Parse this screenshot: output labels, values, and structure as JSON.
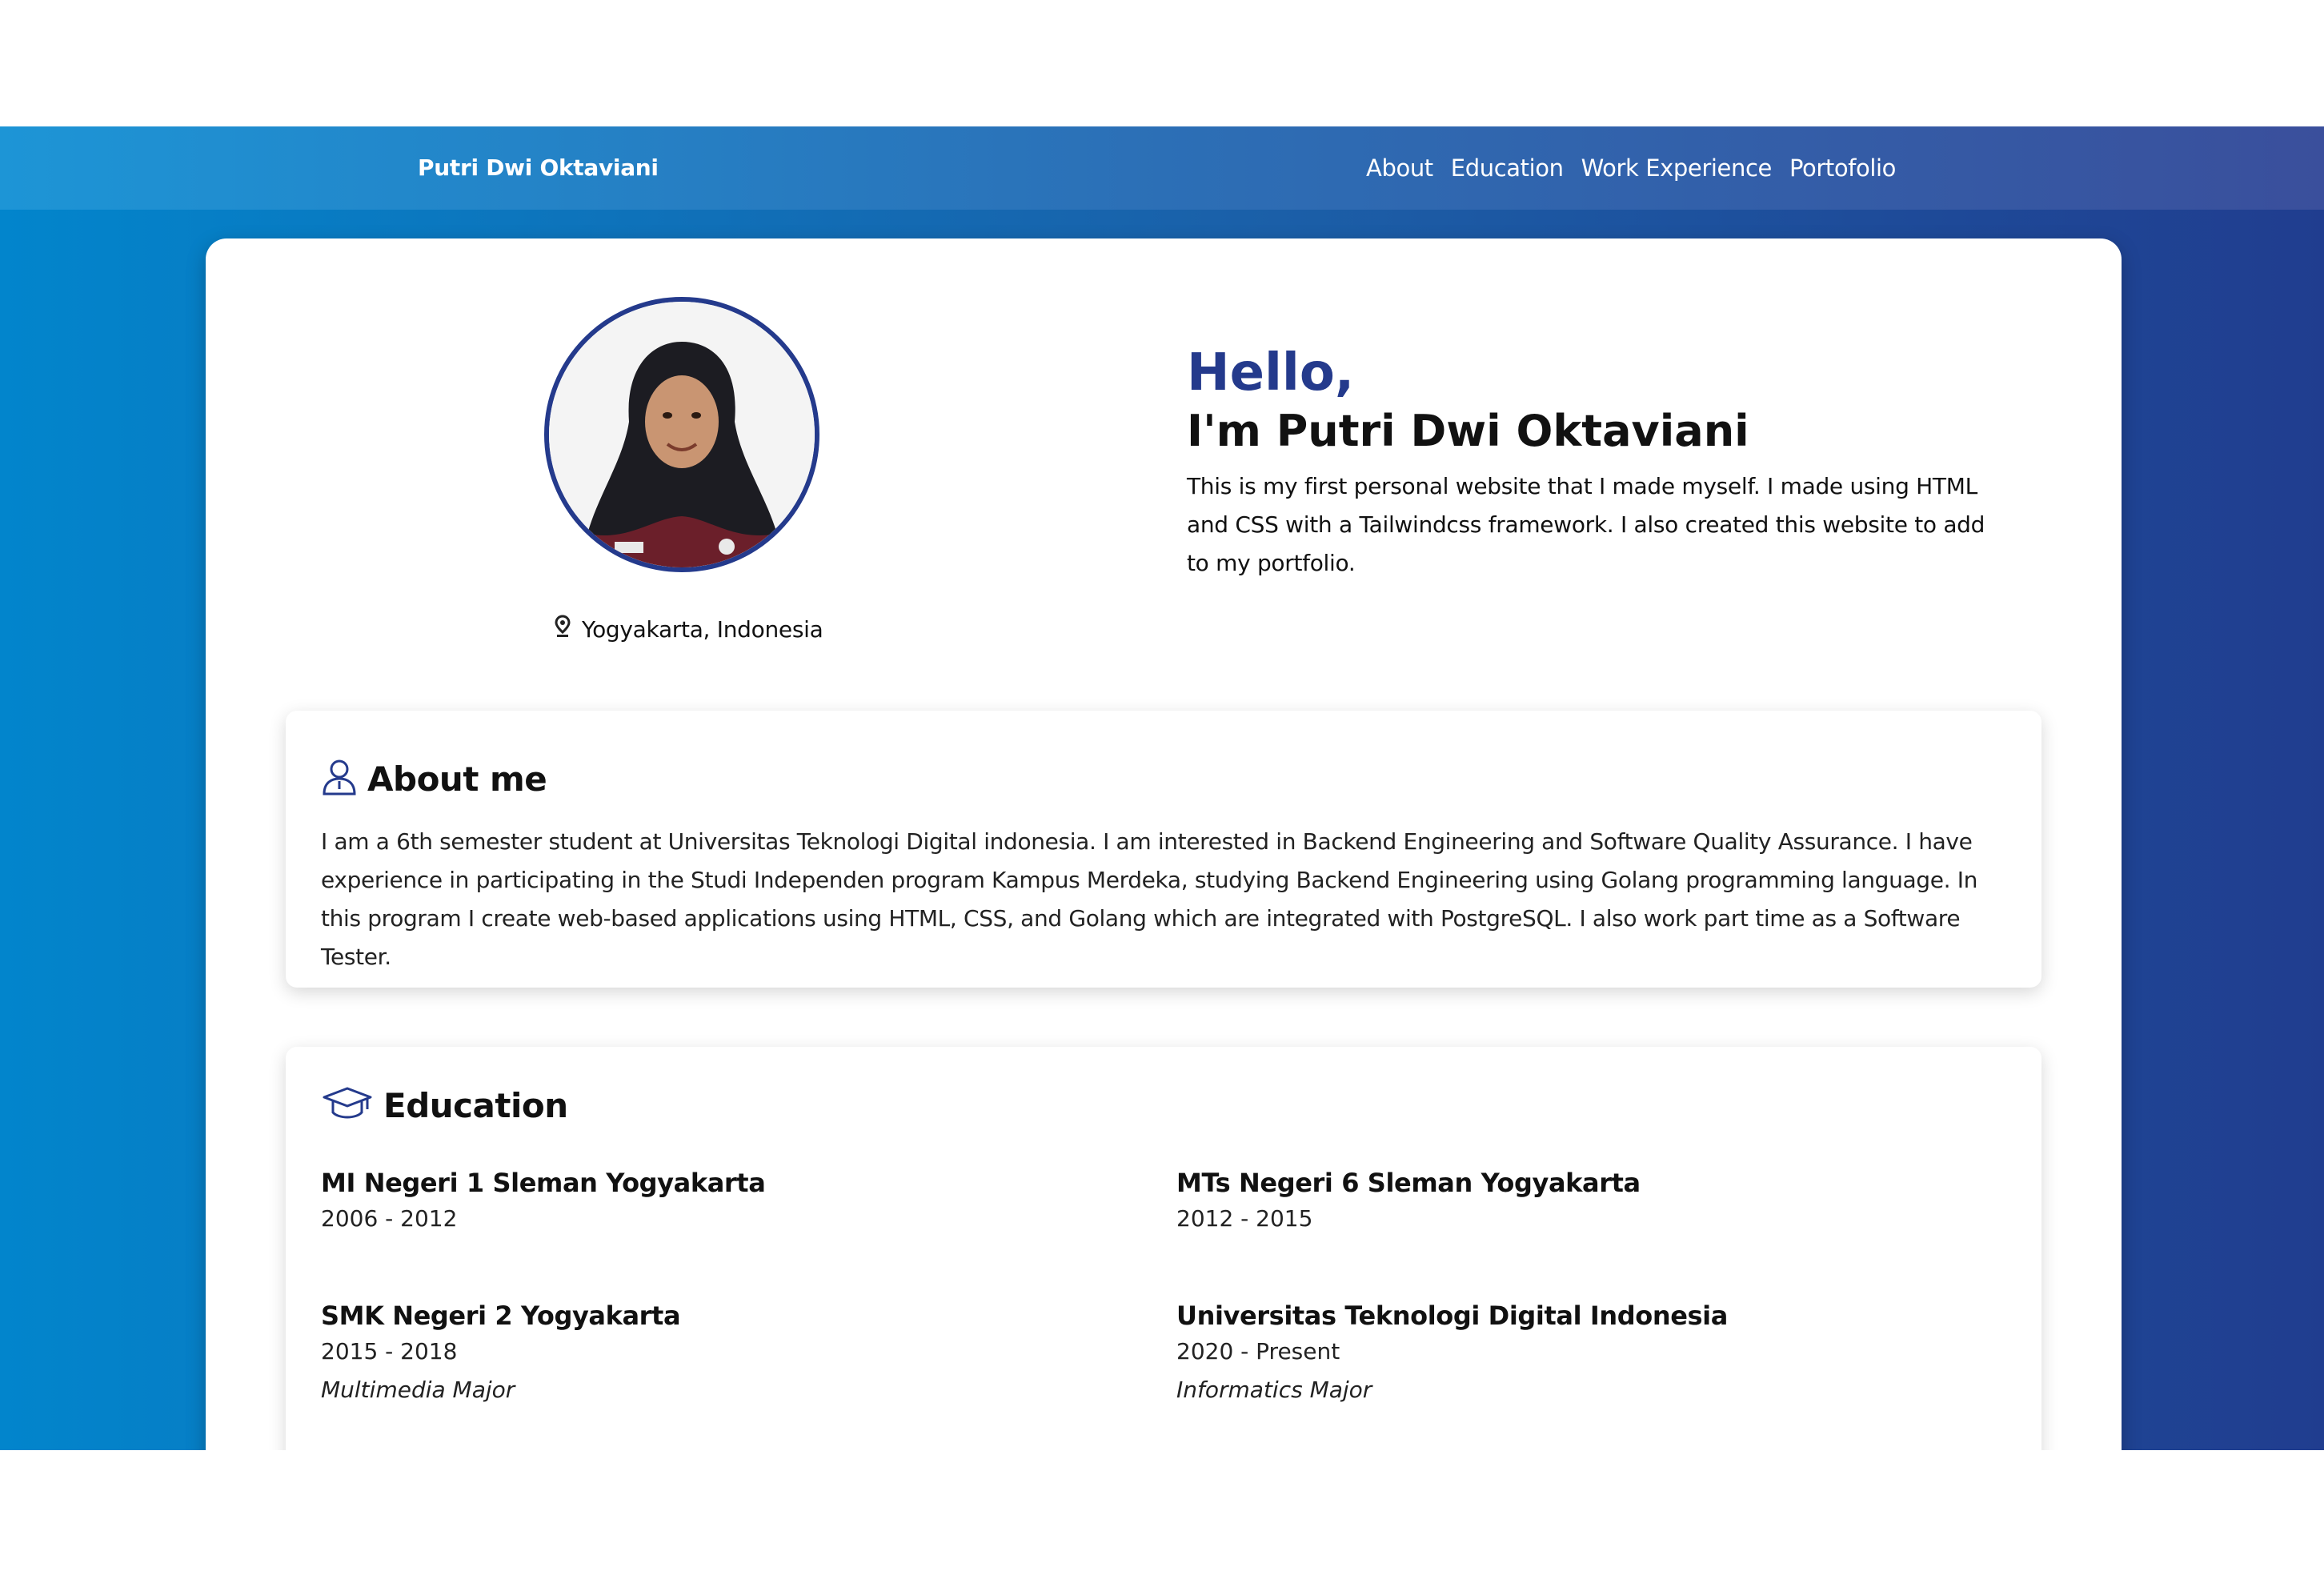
{
  "navbar": {
    "brand": "Putri Dwi Oktaviani",
    "links": [
      "About",
      "Education",
      "Work Experience",
      "Portofolio"
    ]
  },
  "profile": {
    "photo_icon": "profile-photo",
    "location": "Yogyakarta, Indonesia",
    "location_icon": "map-pin-icon"
  },
  "hero": {
    "greeting": "Hello,",
    "name": "I'm Putri Dwi Oktaviani",
    "intro": "This is my first personal website that I made myself. I made using HTML and CSS with a Tailwindcss framework. I also created this website to add to my portfolio."
  },
  "about": {
    "icon": "user-icon",
    "title": "About me",
    "text": "I am a 6th semester student at Universitas Teknologi Digital indonesia. I am interested in Backend Engineering and Software Quality Assurance. I have experience in participating in the Studi Independen program Kampus Merdeka, studying Backend Engineering using Golang programming language. In this program I create web-based applications using HTML, CSS, and Golang which are integrated with PostgreSQL. I also work part time as a Software Tester."
  },
  "education": {
    "icon": "graduation-cap-icon",
    "title": "Education",
    "items": [
      {
        "school": "MI Negeri 1 Sleman Yogyakarta",
        "years": "2006 - 2012",
        "major": ""
      },
      {
        "school": "MTs Negeri 6 Sleman Yogyakarta",
        "years": "2012 - 2015",
        "major": ""
      },
      {
        "school": "SMK Negeri 2 Yogyakarta",
        "years": "2015 - 2018",
        "major": "Multimedia Major"
      },
      {
        "school": "Universitas Teknologi Digital Indonesia",
        "years": "2020 - Present",
        "major": "Informatics Major"
      }
    ]
  },
  "colors": {
    "accent": "#243a8c",
    "nav_start": "#1d95d6",
    "nav_end": "#3a4f9c",
    "bg_start": "#0285cc",
    "bg_end": "#203d8f"
  }
}
